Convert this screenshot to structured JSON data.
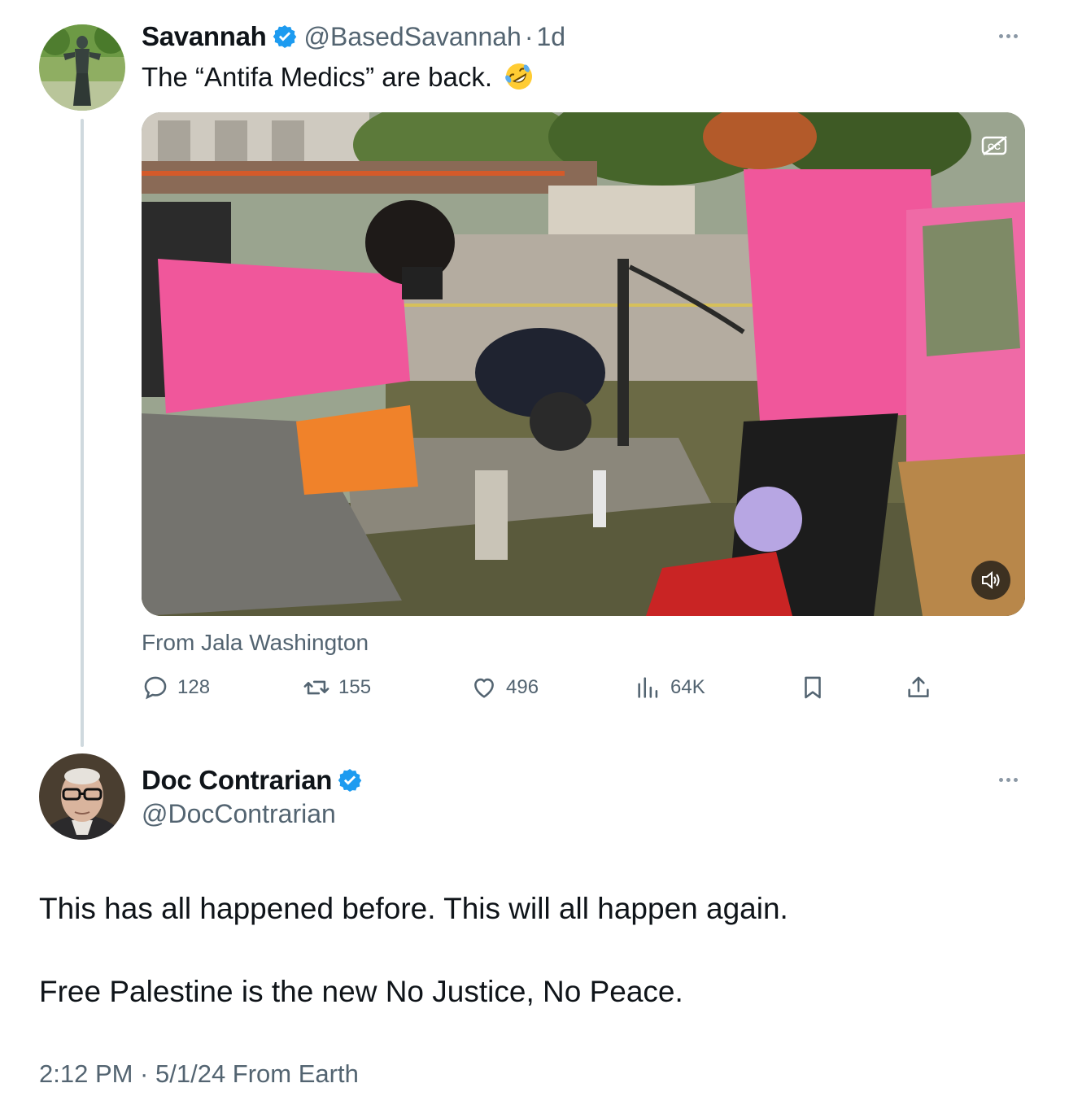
{
  "tweet": {
    "display_name": "Savannah",
    "handle": "@BasedSavannah",
    "separator": "·",
    "time_ago": "1d",
    "text": "The “Antifa Medics” are back.",
    "emoji": "rolling-on-floor-laughing",
    "media_source": "From Jala Washington",
    "stats": {
      "replies": "128",
      "retweets": "155",
      "likes": "496",
      "views": "64K"
    }
  },
  "reply": {
    "display_name": "Doc Contrarian",
    "handle": "@DocContrarian",
    "line1": "This has all happened before. This will all happen again.",
    "line2": "Free Palestine is the new No Justice, No Peace.",
    "timestamp": "2:12 PM · 5/1/24 From Earth"
  },
  "colors": {
    "verified": "#1d9bf0",
    "secondary_text": "#536471",
    "thread_line": "#cfd9de",
    "pink_shirt": "#f0579b"
  }
}
